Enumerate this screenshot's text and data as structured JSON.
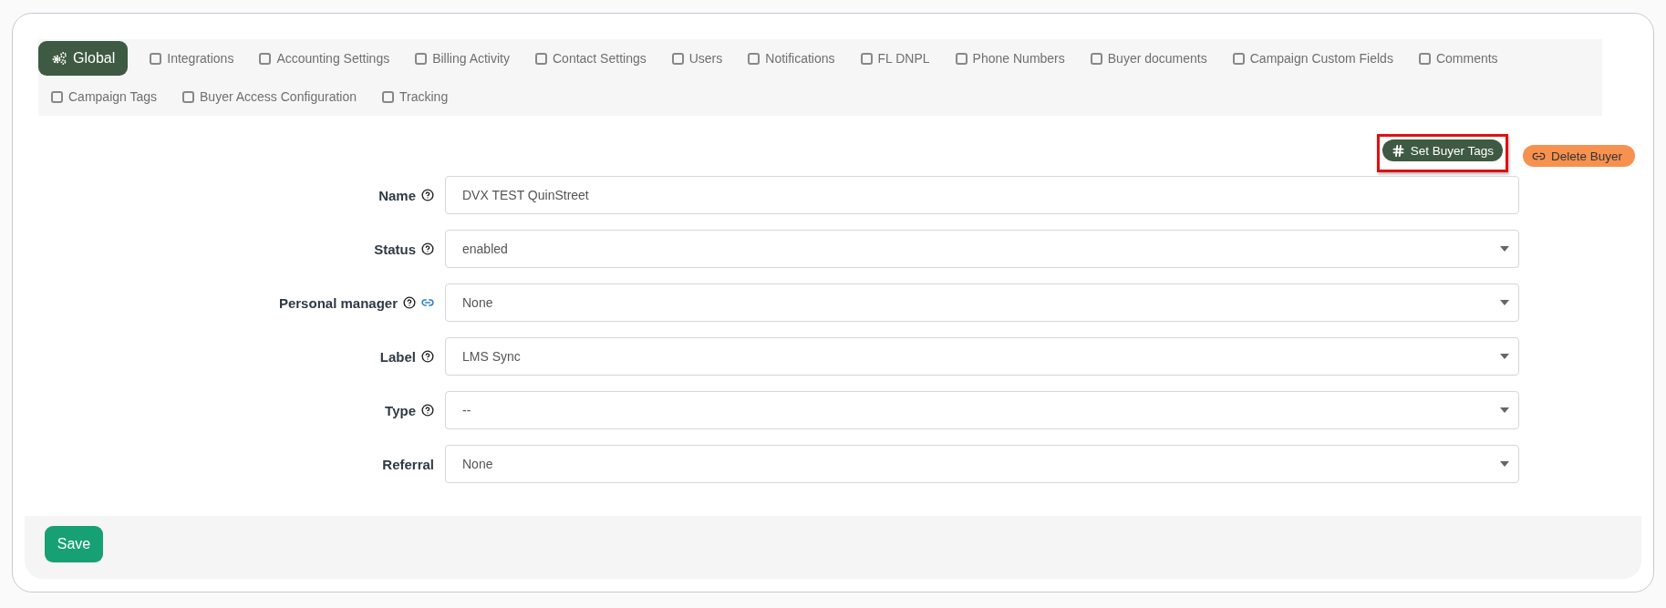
{
  "tabs": [
    {
      "label": "Global",
      "selected": true
    },
    {
      "label": "Integrations",
      "selected": false
    },
    {
      "label": "Accounting Settings",
      "selected": false
    },
    {
      "label": "Billing Activity",
      "selected": false
    },
    {
      "label": "Contact Settings",
      "selected": false
    },
    {
      "label": "Users",
      "selected": false
    },
    {
      "label": "Notifications",
      "selected": false
    },
    {
      "label": "FL DNPL",
      "selected": false
    },
    {
      "label": "Phone Numbers",
      "selected": false
    },
    {
      "label": "Buyer documents",
      "selected": false
    },
    {
      "label": "Campaign Custom Fields",
      "selected": false
    },
    {
      "label": "Comments",
      "selected": false
    },
    {
      "label": "Campaign Tags",
      "selected": false
    },
    {
      "label": "Buyer Access Configuration",
      "selected": false
    },
    {
      "label": "Tracking",
      "selected": false
    }
  ],
  "actions": [
    {
      "label": "Set Buyer Tags",
      "kind": "tags",
      "highlighted": true
    },
    {
      "label": "Delete Buyer",
      "kind": "delete",
      "highlighted": false
    }
  ],
  "fields": [
    {
      "label": "Name",
      "kind": "text",
      "help": true,
      "link": false,
      "value": "DVX TEST QuinStreet"
    },
    {
      "label": "Status",
      "kind": "select",
      "help": true,
      "link": false,
      "value": "enabled"
    },
    {
      "label": "Personal manager",
      "kind": "select",
      "help": true,
      "link": true,
      "value": "None"
    },
    {
      "label": "Label",
      "kind": "select",
      "help": true,
      "link": false,
      "value": "LMS Sync"
    },
    {
      "label": "Type",
      "kind": "select",
      "help": true,
      "link": false,
      "value": "--"
    },
    {
      "label": "Referral",
      "kind": "select",
      "help": false,
      "link": false,
      "value": "None"
    }
  ],
  "footer": {
    "save": "Save"
  }
}
